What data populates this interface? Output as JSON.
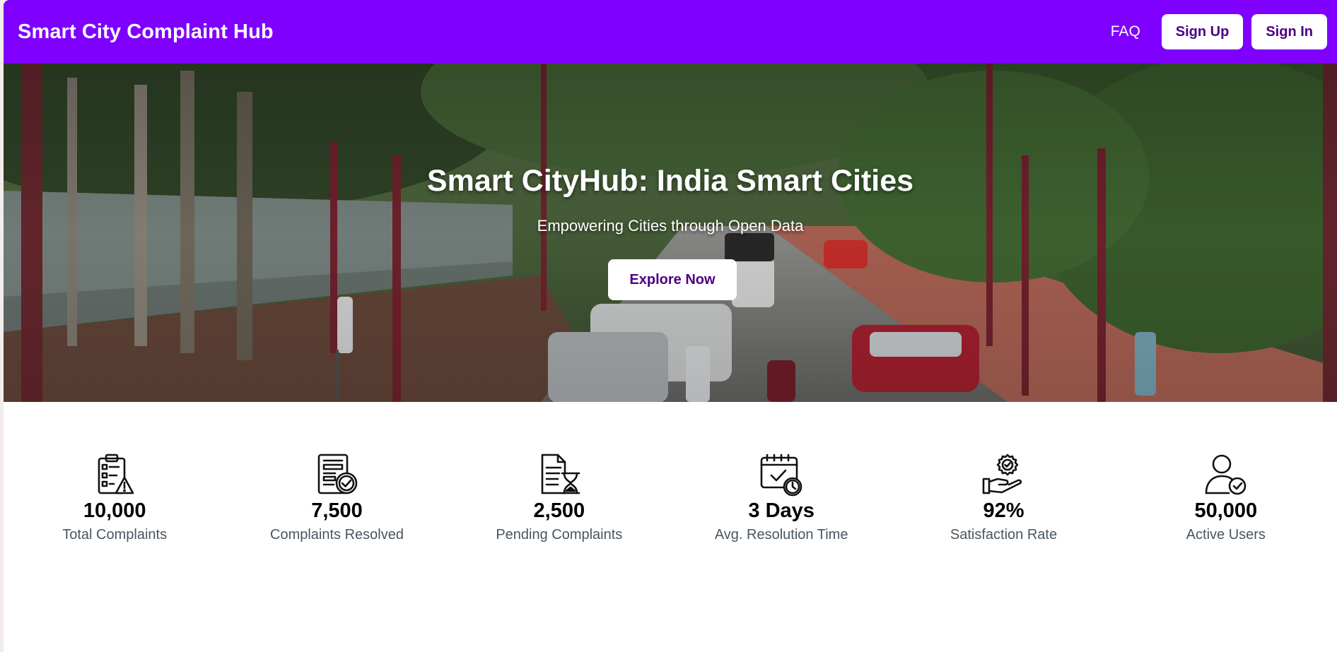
{
  "navbar": {
    "brand": "Smart City Complaint Hub",
    "faq_label": "FAQ",
    "signup_label": "Sign Up",
    "signin_label": "Sign In"
  },
  "hero": {
    "title": "Smart CityHub: India Smart Cities",
    "subtitle": "Empowering Cities through Open Data",
    "cta_label": "Explore Now"
  },
  "stats": [
    {
      "icon": "clipboard-warning-icon",
      "value": "10,000",
      "label": "Total Complaints"
    },
    {
      "icon": "document-check-icon",
      "value": "7,500",
      "label": "Complaints Resolved"
    },
    {
      "icon": "document-hourglass-icon",
      "value": "2,500",
      "label": "Pending Complaints"
    },
    {
      "icon": "calendar-clock-icon",
      "value": "3 Days",
      "label": "Avg. Resolution Time"
    },
    {
      "icon": "hand-badge-icon",
      "value": "92%",
      "label": "Satisfaction Rate"
    },
    {
      "icon": "user-check-icon",
      "value": "50,000",
      "label": "Active Users"
    }
  ],
  "colors": {
    "navbar_bg": "#7f00ff",
    "button_text": "#4b0082",
    "stat_label": "#4a5560"
  }
}
